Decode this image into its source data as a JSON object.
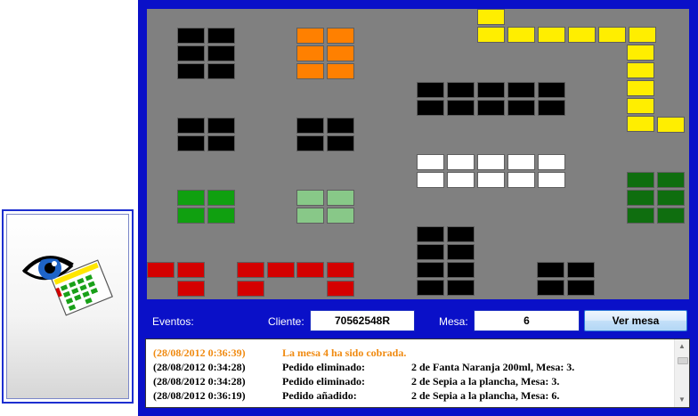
{
  "app_icon": {
    "name": "eye-reviewing-floor-plan-icon"
  },
  "floor_plan": {
    "background": "#808080",
    "colors": {
      "black": "#000000",
      "orange": "#ff8000",
      "yellow": "#ffee00",
      "white": "#ffffff",
      "green": "#10a010",
      "light_green": "#88c888",
      "dark_green": "#0f6e0f",
      "red": "#d40000"
    }
  },
  "footer": {
    "eventos_label": "Eventos:",
    "cliente_label": "Cliente:",
    "cliente_value": "70562548R",
    "mesa_label": "Mesa:",
    "mesa_value": "6",
    "ver_mesa_button": "Ver mesa"
  },
  "log": {
    "entries": [
      {
        "time": "(28/08/2012 0:36:39)",
        "event": "La mesa 4 ha sido cobrada.",
        "detail": "",
        "highlight": true
      },
      {
        "time": "(28/08/2012 0:34:28)",
        "event": "Pedido eliminado:",
        "detail": "2 de Fanta Naranja 200ml, Mesa: 3.",
        "highlight": false
      },
      {
        "time": "(28/08/2012 0:34:28)",
        "event": "Pedido eliminado:",
        "detail": "2 de Sepia a la plancha, Mesa: 3.",
        "highlight": false
      },
      {
        "time": "(28/08/2012 0:36:19)",
        "event": "Pedido añadido:",
        "detail": "2 de Sepia a la plancha, Mesa: 6.",
        "highlight": false
      }
    ]
  }
}
